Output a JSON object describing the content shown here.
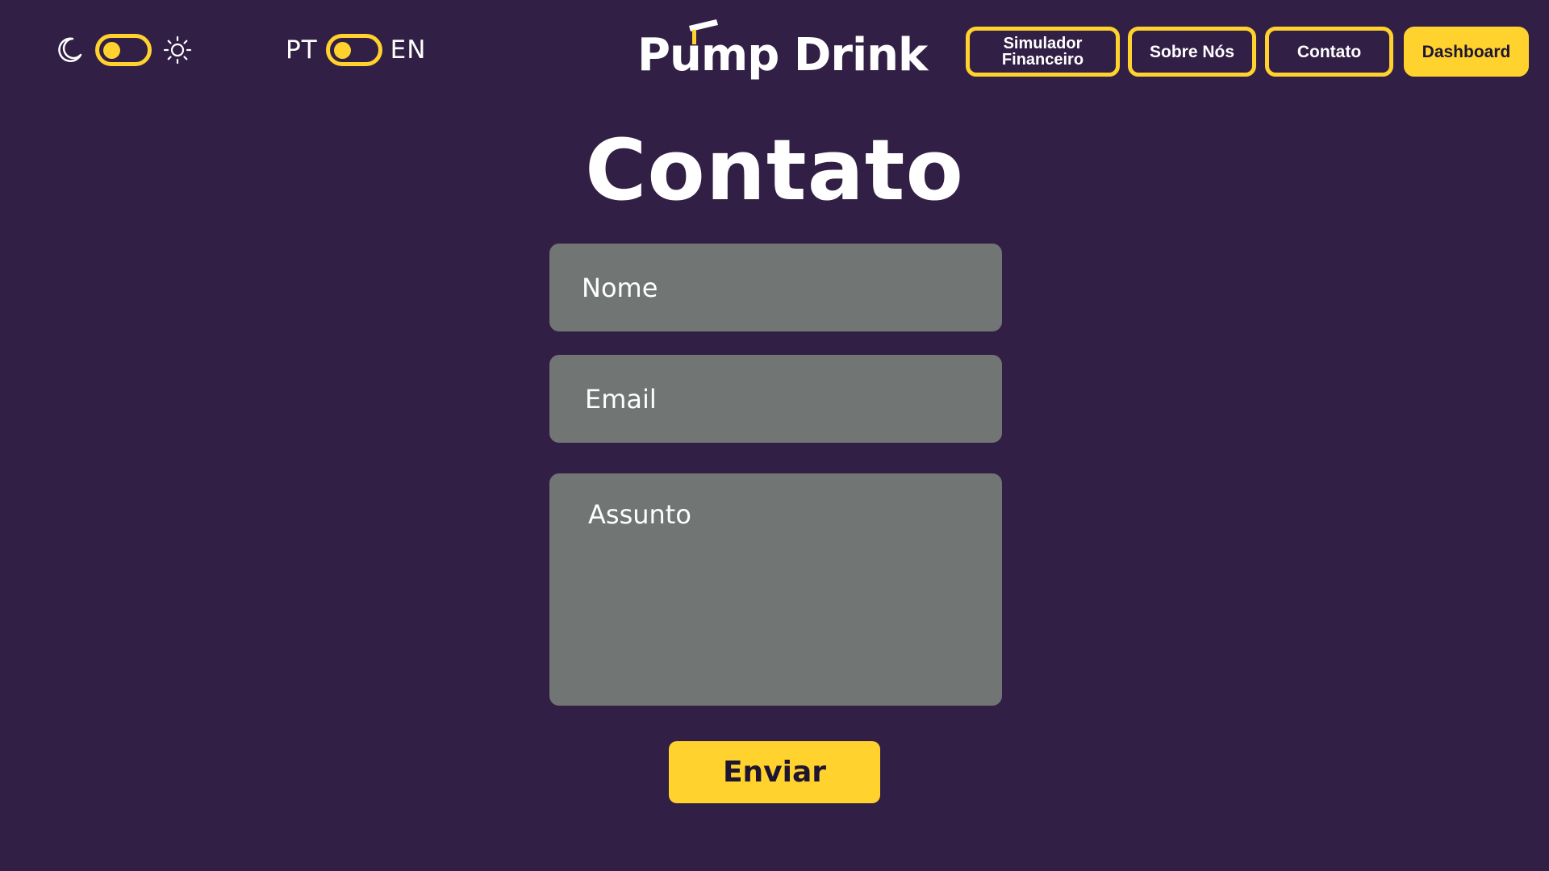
{
  "theme": {
    "dark_icon": "moon-icon",
    "light_icon": "sun-icon",
    "accent_color": "#ffd22e",
    "background_color": "#321f45",
    "field_color": "#717574"
  },
  "language": {
    "left_label": "PT",
    "right_label": "EN"
  },
  "brand": {
    "name": "Pump Drink"
  },
  "nav": {
    "simulator_line1": "Simulador",
    "simulator_line2": "Financeiro",
    "about": "Sobre Nós",
    "contact": "Contato",
    "dashboard": "Dashboard"
  },
  "page": {
    "title": "Contato"
  },
  "form": {
    "name_placeholder": "Nome",
    "email_placeholder": "Email",
    "subject_placeholder": "Assunto",
    "submit_label": "Enviar"
  }
}
